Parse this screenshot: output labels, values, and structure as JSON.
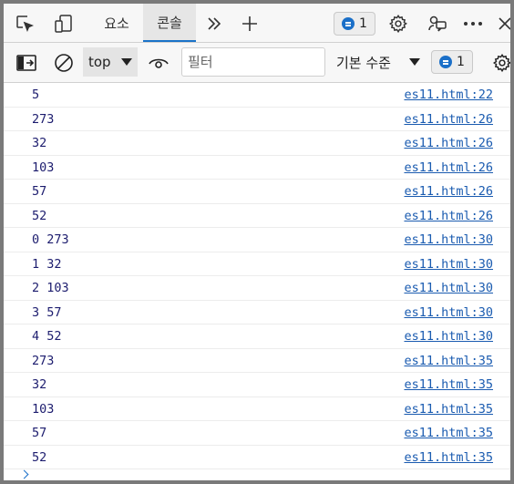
{
  "tabs": [
    {
      "label": "요소"
    },
    {
      "label": "콘솔"
    }
  ],
  "tabbar": {
    "issues_count": "1"
  },
  "toolbar": {
    "context": "top",
    "filter_placeholder": "필터",
    "levels_label": "기본 수준",
    "issues_count": "1"
  },
  "console": {
    "rows": [
      {
        "message": "5",
        "source": "es11.html:22"
      },
      {
        "message": "273",
        "source": "es11.html:26"
      },
      {
        "message": "32",
        "source": "es11.html:26"
      },
      {
        "message": "103",
        "source": "es11.html:26"
      },
      {
        "message": "57",
        "source": "es11.html:26"
      },
      {
        "message": "52",
        "source": "es11.html:26"
      },
      {
        "message": "0 273",
        "source": "es11.html:30"
      },
      {
        "message": "1 32",
        "source": "es11.html:30"
      },
      {
        "message": "2 103",
        "source": "es11.html:30"
      },
      {
        "message": "3 57",
        "source": "es11.html:30"
      },
      {
        "message": "4 52",
        "source": "es11.html:30"
      },
      {
        "message": "273",
        "source": "es11.html:35"
      },
      {
        "message": "32",
        "source": "es11.html:35"
      },
      {
        "message": "103",
        "source": "es11.html:35"
      },
      {
        "message": "57",
        "source": "es11.html:35"
      },
      {
        "message": "52",
        "source": "es11.html:35"
      }
    ]
  }
}
